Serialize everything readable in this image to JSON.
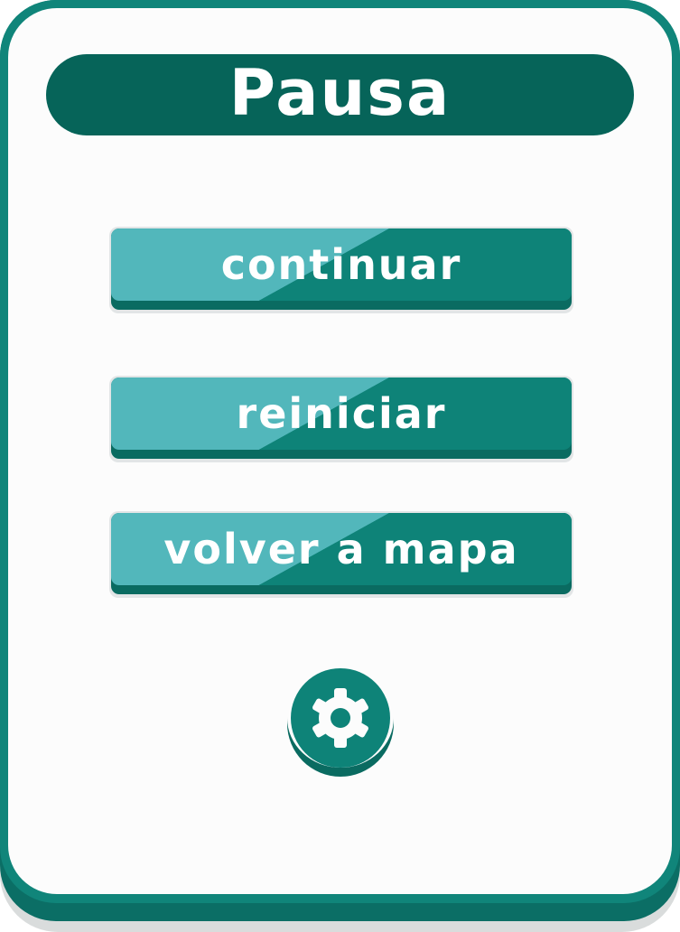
{
  "dialog": {
    "title": "Pausa"
  },
  "menu": {
    "continue_label": "continuar",
    "restart_label": "reiniciar",
    "map_label": "volver a mapa"
  },
  "settings": {
    "icon": "gear-icon"
  },
  "colors": {
    "panel_border": "#10857a",
    "title_bar": "#066459",
    "button_light": "#52b7bb",
    "button_dark": "#0e8378",
    "panel_background": "#fcfcfc"
  }
}
